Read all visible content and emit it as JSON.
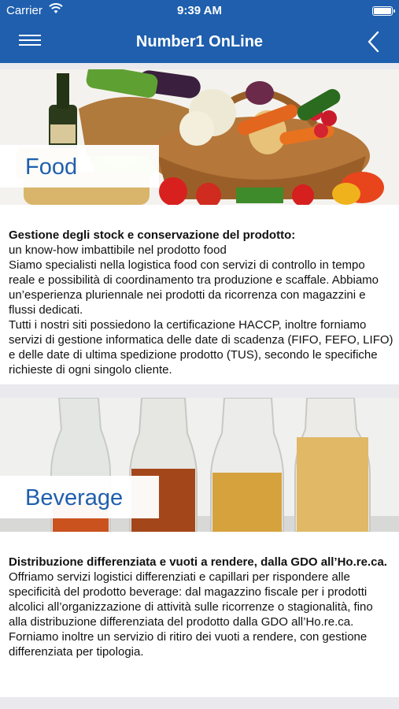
{
  "status_bar": {
    "carrier": "Carrier",
    "time": "9:39 AM",
    "wifi_icon": "wifi-icon",
    "battery_icon": "battery-icon"
  },
  "nav": {
    "title": "Number1 OnLine",
    "menu_icon": "hamburger-menu-icon",
    "back_icon": "chevron-left-icon"
  },
  "colors": {
    "brand": "#1f5fae",
    "background": "#e9e9ee",
    "card": "#ffffff"
  },
  "sections": [
    {
      "label": "Food",
      "image": "fruit-vegetable-basket-image",
      "heading": "Gestione degli stock e conservazione del prodotto:",
      "paragraphs": [
        "un know-how imbattibile nel prodotto food",
        "Siamo specialisti nella logistica food con servizi di controllo in tempo reale e possibilità di coordinamento tra produzione e scaffale. Abbiamo un’esperienza pluriennale nei prodotti da ricorrenza con magazzini e flussi dedicati.",
        "Tutti i nostri siti possiedono la certificazione HACCP, inoltre forniamo servizi di gestione informatica delle date di scadenza (FIFO, FEFO, LIFO) e delle date di ultima spedizione prodotto (TUS), secondo le specifiche richieste di ogni singolo cliente."
      ]
    },
    {
      "label": "Beverage",
      "image": "bottles-image",
      "heading": "Distribuzione differenziata e vuoti a rendere, dalla GDO all’Ho.re.ca.",
      "paragraphs": [
        "Offriamo servizi logistici differenziati e capillari per rispondere alle specificità del prodotto beverage: dal magazzino fiscale per i prodotti alcolici all’organizzazione di attività sulle ricorrenze o stagionalità, fino alla distribuzione differenziata del prodotto dalla GDO all’Ho.re.ca.",
        "Forniamo inoltre un servizio di ritiro dei vuoti a rendere, con gestione differenziata per tipologia."
      ]
    }
  ]
}
